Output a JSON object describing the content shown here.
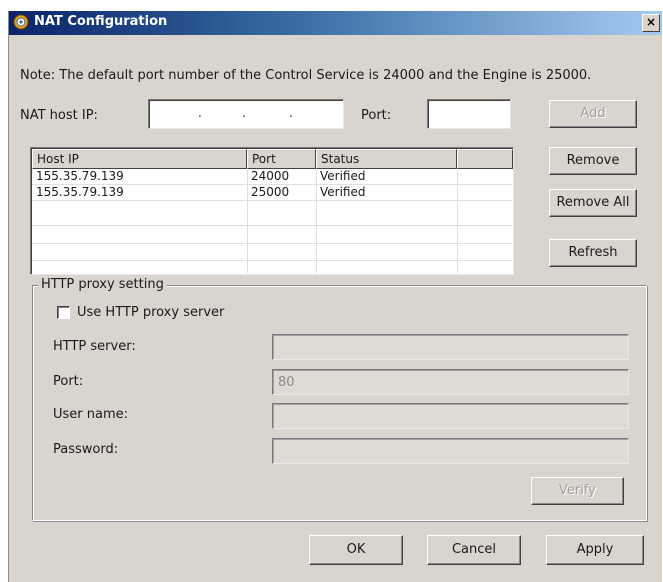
{
  "window": {
    "title": "NAT Configuration",
    "close_glyph": "×"
  },
  "note": "Note: The default port number of the Control Service is 24000 and the Engine is 25000.",
  "nat": {
    "host_ip_label": "NAT host IP:",
    "host_ip_dots": ".",
    "port_label": "Port:",
    "port_value": ""
  },
  "table": {
    "columns": [
      "Host IP",
      "Port",
      "Status",
      ""
    ],
    "rows": [
      [
        "155.35.79.139",
        "24000",
        "Verified"
      ],
      [
        "155.35.79.139",
        "25000",
        "Verified"
      ]
    ]
  },
  "buttons": {
    "add": "Add",
    "remove": "Remove",
    "remove_all": "Remove All",
    "refresh": "Refresh",
    "verify": "Verify",
    "ok": "OK",
    "cancel": "Cancel",
    "apply": "Apply"
  },
  "proxy": {
    "group_title": "HTTP proxy setting",
    "use_proxy_label": "Use HTTP proxy server",
    "use_proxy_checked": false,
    "server_label": "HTTP server:",
    "server_value": "",
    "port_label": "Port:",
    "port_value": "80",
    "user_label": "User name:",
    "user_value": "",
    "password_label": "Password:",
    "password_value": ""
  },
  "colors": {
    "dialog_bg": "#d9d5ce",
    "titlebar_start": "#0a246a",
    "titlebar_end": "#a6caf0"
  },
  "icons": {
    "title": "nat-gear-icon",
    "close": "close-icon"
  }
}
